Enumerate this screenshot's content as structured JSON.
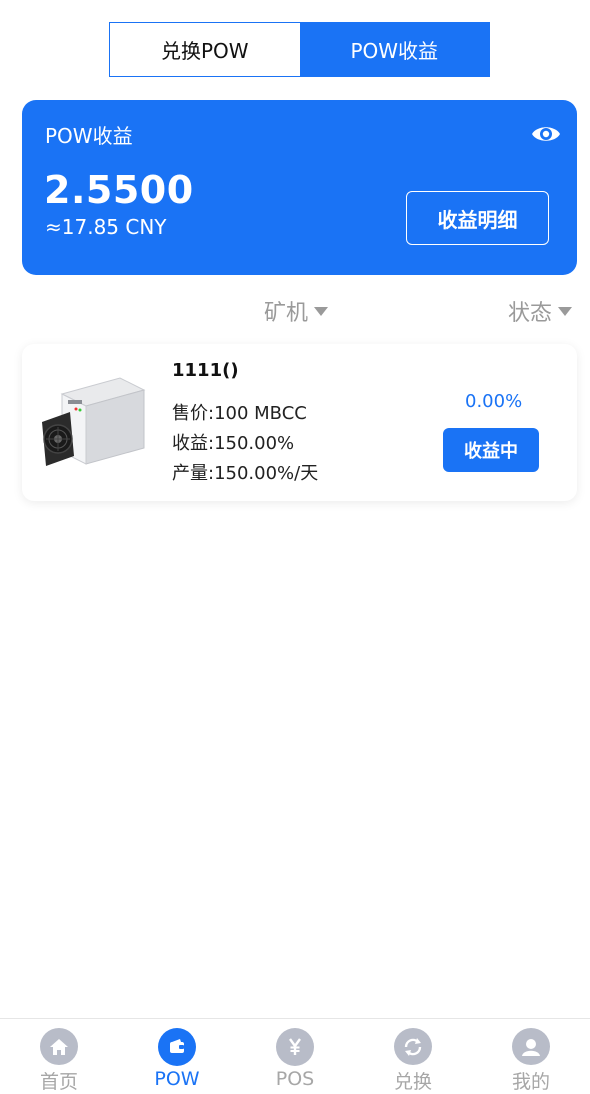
{
  "tabs": {
    "exchange_label": "兑换POW",
    "earnings_label": "POW收益",
    "active": "earnings"
  },
  "earnings_card": {
    "title": "POW收益",
    "amount": "2.5500",
    "cny": "≈17.85 CNY",
    "detail_button": "收益明细",
    "eye_icon": "eye-icon"
  },
  "filters": {
    "miner": "矿机",
    "status": "状态"
  },
  "miners": [
    {
      "name": "1111()",
      "price": "售价:100 MBCC",
      "yield": "收益:150.00%",
      "output": "产量:150.00%/天",
      "progress": "0.00%",
      "status": "收益中"
    }
  ],
  "bottom_nav": [
    {
      "label": "首页",
      "icon": "home-icon"
    },
    {
      "label": "POW",
      "icon": "wallet-icon",
      "active": true
    },
    {
      "label": "POS",
      "icon": "yen-icon"
    },
    {
      "label": "兑换",
      "icon": "exchange-icon"
    },
    {
      "label": "我的",
      "icon": "user-icon"
    }
  ],
  "colors": {
    "primary": "#1a73f5",
    "muted": "#9a9a9a",
    "nav_inactive": "#b8bcc8"
  }
}
